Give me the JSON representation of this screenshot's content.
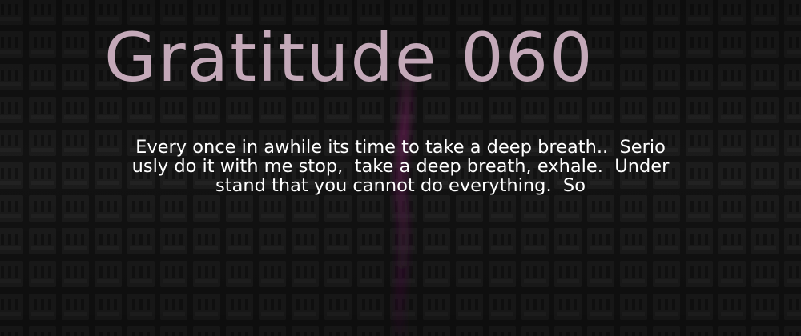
{
  "post": {
    "title": "Gratitude 060",
    "description_lines": [
      "Every once in awhile its time to take a deep breath..  Serio",
      "usly do it with me stop,  take a deep breath, exhale.  Under",
      "stand that you cannot do everything.  So"
    ]
  },
  "colors": {
    "background": "#131313",
    "pattern_block": "#202020",
    "title": "#c4a9b9",
    "text": "#ffffff",
    "accent_glow": "#6a1a55"
  },
  "icons": {
    "background_pattern": "repeating-logo-pattern-icon"
  }
}
